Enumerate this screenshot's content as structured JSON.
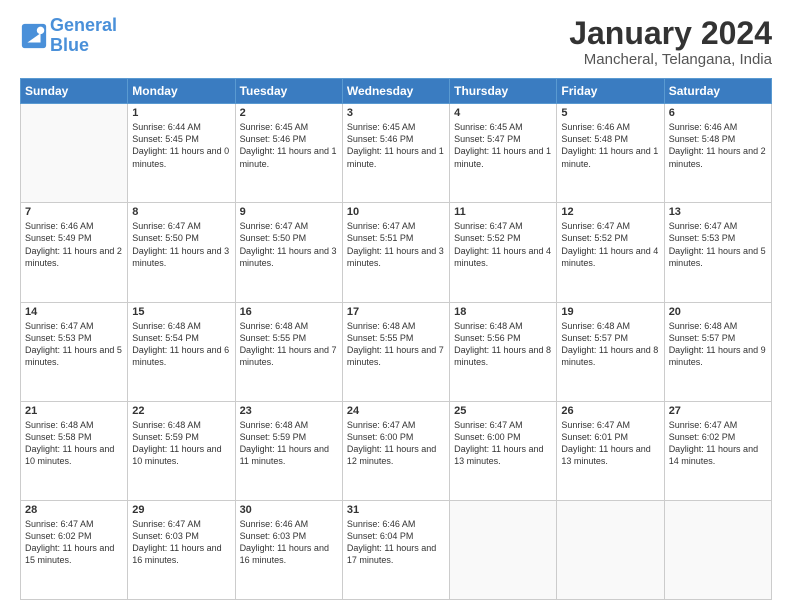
{
  "header": {
    "logo_line1": "General",
    "logo_line2": "Blue",
    "month": "January 2024",
    "location": "Mancheral, Telangana, India"
  },
  "weekdays": [
    "Sunday",
    "Monday",
    "Tuesday",
    "Wednesday",
    "Thursday",
    "Friday",
    "Saturday"
  ],
  "weeks": [
    [
      {
        "day": "",
        "sunrise": "",
        "sunset": "",
        "daylight": ""
      },
      {
        "day": "1",
        "sunrise": "Sunrise: 6:44 AM",
        "sunset": "Sunset: 5:45 PM",
        "daylight": "Daylight: 11 hours and 0 minutes."
      },
      {
        "day": "2",
        "sunrise": "Sunrise: 6:45 AM",
        "sunset": "Sunset: 5:46 PM",
        "daylight": "Daylight: 11 hours and 1 minute."
      },
      {
        "day": "3",
        "sunrise": "Sunrise: 6:45 AM",
        "sunset": "Sunset: 5:46 PM",
        "daylight": "Daylight: 11 hours and 1 minute."
      },
      {
        "day": "4",
        "sunrise": "Sunrise: 6:45 AM",
        "sunset": "Sunset: 5:47 PM",
        "daylight": "Daylight: 11 hours and 1 minute."
      },
      {
        "day": "5",
        "sunrise": "Sunrise: 6:46 AM",
        "sunset": "Sunset: 5:48 PM",
        "daylight": "Daylight: 11 hours and 1 minute."
      },
      {
        "day": "6",
        "sunrise": "Sunrise: 6:46 AM",
        "sunset": "Sunset: 5:48 PM",
        "daylight": "Daylight: 11 hours and 2 minutes."
      }
    ],
    [
      {
        "day": "7",
        "sunrise": "Sunrise: 6:46 AM",
        "sunset": "Sunset: 5:49 PM",
        "daylight": "Daylight: 11 hours and 2 minutes."
      },
      {
        "day": "8",
        "sunrise": "Sunrise: 6:47 AM",
        "sunset": "Sunset: 5:50 PM",
        "daylight": "Daylight: 11 hours and 3 minutes."
      },
      {
        "day": "9",
        "sunrise": "Sunrise: 6:47 AM",
        "sunset": "Sunset: 5:50 PM",
        "daylight": "Daylight: 11 hours and 3 minutes."
      },
      {
        "day": "10",
        "sunrise": "Sunrise: 6:47 AM",
        "sunset": "Sunset: 5:51 PM",
        "daylight": "Daylight: 11 hours and 3 minutes."
      },
      {
        "day": "11",
        "sunrise": "Sunrise: 6:47 AM",
        "sunset": "Sunset: 5:52 PM",
        "daylight": "Daylight: 11 hours and 4 minutes."
      },
      {
        "day": "12",
        "sunrise": "Sunrise: 6:47 AM",
        "sunset": "Sunset: 5:52 PM",
        "daylight": "Daylight: 11 hours and 4 minutes."
      },
      {
        "day": "13",
        "sunrise": "Sunrise: 6:47 AM",
        "sunset": "Sunset: 5:53 PM",
        "daylight": "Daylight: 11 hours and 5 minutes."
      }
    ],
    [
      {
        "day": "14",
        "sunrise": "Sunrise: 6:47 AM",
        "sunset": "Sunset: 5:53 PM",
        "daylight": "Daylight: 11 hours and 5 minutes."
      },
      {
        "day": "15",
        "sunrise": "Sunrise: 6:48 AM",
        "sunset": "Sunset: 5:54 PM",
        "daylight": "Daylight: 11 hours and 6 minutes."
      },
      {
        "day": "16",
        "sunrise": "Sunrise: 6:48 AM",
        "sunset": "Sunset: 5:55 PM",
        "daylight": "Daylight: 11 hours and 7 minutes."
      },
      {
        "day": "17",
        "sunrise": "Sunrise: 6:48 AM",
        "sunset": "Sunset: 5:55 PM",
        "daylight": "Daylight: 11 hours and 7 minutes."
      },
      {
        "day": "18",
        "sunrise": "Sunrise: 6:48 AM",
        "sunset": "Sunset: 5:56 PM",
        "daylight": "Daylight: 11 hours and 8 minutes."
      },
      {
        "day": "19",
        "sunrise": "Sunrise: 6:48 AM",
        "sunset": "Sunset: 5:57 PM",
        "daylight": "Daylight: 11 hours and 8 minutes."
      },
      {
        "day": "20",
        "sunrise": "Sunrise: 6:48 AM",
        "sunset": "Sunset: 5:57 PM",
        "daylight": "Daylight: 11 hours and 9 minutes."
      }
    ],
    [
      {
        "day": "21",
        "sunrise": "Sunrise: 6:48 AM",
        "sunset": "Sunset: 5:58 PM",
        "daylight": "Daylight: 11 hours and 10 minutes."
      },
      {
        "day": "22",
        "sunrise": "Sunrise: 6:48 AM",
        "sunset": "Sunset: 5:59 PM",
        "daylight": "Daylight: 11 hours and 10 minutes."
      },
      {
        "day": "23",
        "sunrise": "Sunrise: 6:48 AM",
        "sunset": "Sunset: 5:59 PM",
        "daylight": "Daylight: 11 hours and 11 minutes."
      },
      {
        "day": "24",
        "sunrise": "Sunrise: 6:47 AM",
        "sunset": "Sunset: 6:00 PM",
        "daylight": "Daylight: 11 hours and 12 minutes."
      },
      {
        "day": "25",
        "sunrise": "Sunrise: 6:47 AM",
        "sunset": "Sunset: 6:00 PM",
        "daylight": "Daylight: 11 hours and 13 minutes."
      },
      {
        "day": "26",
        "sunrise": "Sunrise: 6:47 AM",
        "sunset": "Sunset: 6:01 PM",
        "daylight": "Daylight: 11 hours and 13 minutes."
      },
      {
        "day": "27",
        "sunrise": "Sunrise: 6:47 AM",
        "sunset": "Sunset: 6:02 PM",
        "daylight": "Daylight: 11 hours and 14 minutes."
      }
    ],
    [
      {
        "day": "28",
        "sunrise": "Sunrise: 6:47 AM",
        "sunset": "Sunset: 6:02 PM",
        "daylight": "Daylight: 11 hours and 15 minutes."
      },
      {
        "day": "29",
        "sunrise": "Sunrise: 6:47 AM",
        "sunset": "Sunset: 6:03 PM",
        "daylight": "Daylight: 11 hours and 16 minutes."
      },
      {
        "day": "30",
        "sunrise": "Sunrise: 6:46 AM",
        "sunset": "Sunset: 6:03 PM",
        "daylight": "Daylight: 11 hours and 16 minutes."
      },
      {
        "day": "31",
        "sunrise": "Sunrise: 6:46 AM",
        "sunset": "Sunset: 6:04 PM",
        "daylight": "Daylight: 11 hours and 17 minutes."
      },
      {
        "day": "",
        "sunrise": "",
        "sunset": "",
        "daylight": ""
      },
      {
        "day": "",
        "sunrise": "",
        "sunset": "",
        "daylight": ""
      },
      {
        "day": "",
        "sunrise": "",
        "sunset": "",
        "daylight": ""
      }
    ]
  ]
}
